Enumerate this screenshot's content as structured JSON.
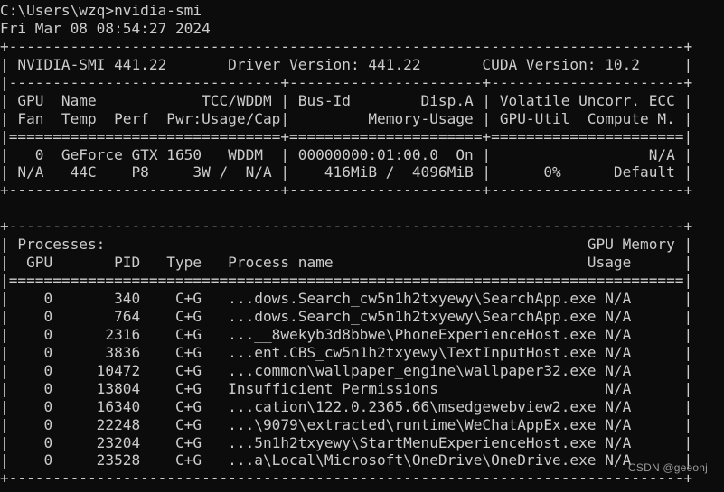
{
  "terminal": {
    "background_color": "#0c0c0c",
    "text_color": "#cccccc",
    "prompt_line": "C:\\Users\\wzq>nvidia-smi",
    "timestamp_line": "Fri Mar 08 08:54:27 2024",
    "blank_line": "",
    "watermark": "CSDN @geeonj"
  },
  "smi_table": {
    "border_top": "+-----------------------------------------------------------------------------+",
    "header_line": "| NVIDIA-SMI 441.22       Driver Version: 441.22       CUDA Version: 10.2     |",
    "divider_dashed": "|-------------------------------+----------------------+----------------------+",
    "col_header_1": "| GPU  Name            TCC/WDDM | Bus-Id        Disp.A | Volatile Uncorr. ECC |",
    "col_header_2": "| Fan  Temp  Perf  Pwr:Usage/Cap|         Memory-Usage | GPU-Util  Compute M. |",
    "divider_equals": "|===============================+======================+======================|",
    "gpu_row_1": "|   0  GeForce GTX 1650   WDDM  | 00000000:01:00.0  On |                  N/A |",
    "gpu_row_2": "| N/A   44C    P8     3W /  N/A |    416MiB /  4096MiB |      0%      Default |",
    "border_bottom": "+-------------------------------+----------------------+----------------------+",
    "fields": {
      "nvidia_smi_version": "441.22",
      "driver_version": "441.22",
      "cuda_version": "10.2",
      "gpu_index": "0",
      "gpu_name": "GeForce GTX 1650",
      "tcc_wddm": "WDDM",
      "bus_id": "00000000:01:00.0",
      "disp_a": "On",
      "ecc": "N/A",
      "fan": "N/A",
      "temp": "44C",
      "perf": "P8",
      "pwr_usage_cap": "3W /  N/A",
      "memory_usage": "416MiB /  4096MiB",
      "gpu_util": "0%",
      "compute_m": "Default"
    }
  },
  "processes_table": {
    "border_top": "+-----------------------------------------------------------------------------+",
    "title_line": "| Processes:                                                       GPU Memory |",
    "header_line": "|  GPU       PID   Type   Process name                             Usage      |",
    "divider_equals": "|=============================================================================|",
    "border_bottom": "+-----------------------------------------------------------------------------+",
    "columns": [
      "GPU",
      "PID",
      "Type",
      "Process name",
      "Usage"
    ],
    "rows": [
      {
        "line": "|    0       340    C+G   ...dows.Search_cw5n1h2txyewy\\SearchApp.exe N/A      |",
        "gpu": "0",
        "pid": "340",
        "type": "C+G",
        "name": "...dows.Search_cw5n1h2txyewy\\SearchApp.exe",
        "usage": "N/A"
      },
      {
        "line": "|    0       764    C+G   ...dows.Search_cw5n1h2txyewy\\SearchApp.exe N/A      |",
        "gpu": "0",
        "pid": "764",
        "type": "C+G",
        "name": "...dows.Search_cw5n1h2txyewy\\SearchApp.exe",
        "usage": "N/A"
      },
      {
        "line": "|    0      2316    C+G   ...__8wekyb3d8bbwe\\PhoneExperienceHost.exe N/A      |",
        "gpu": "0",
        "pid": "2316",
        "type": "C+G",
        "name": "...__8wekyb3d8bbwe\\PhoneExperienceHost.exe",
        "usage": "N/A"
      },
      {
        "line": "|    0      3836    C+G   ...ent.CBS_cw5n1h2txyewy\\TextInputHost.exe N/A      |",
        "gpu": "0",
        "pid": "3836",
        "type": "C+G",
        "name": "...ent.CBS_cw5n1h2txyewy\\TextInputHost.exe",
        "usage": "N/A"
      },
      {
        "line": "|    0     10472    C+G   ...common\\wallpaper_engine\\wallpaper32.exe N/A      |",
        "gpu": "0",
        "pid": "10472",
        "type": "C+G",
        "name": "...common\\wallpaper_engine\\wallpaper32.exe",
        "usage": "N/A"
      },
      {
        "line": "|    0     13804    C+G   Insufficient Permissions                   N/A      |",
        "gpu": "0",
        "pid": "13804",
        "type": "C+G",
        "name": "Insufficient Permissions",
        "usage": "N/A"
      },
      {
        "line": "|    0     16340    C+G   ...cation\\122.0.2365.66\\msedgewebview2.exe N/A      |",
        "gpu": "0",
        "pid": "16340",
        "type": "C+G",
        "name": "...cation\\122.0.2365.66\\msedgewebview2.exe",
        "usage": "N/A"
      },
      {
        "line": "|    0     22248    C+G   ...\\9079\\extracted\\runtime\\WeChatAppEx.exe N/A      |",
        "gpu": "0",
        "pid": "22248",
        "type": "C+G",
        "name": "...\\9079\\extracted\\runtime\\WeChatAppEx.exe",
        "usage": "N/A"
      },
      {
        "line": "|    0     23204    C+G   ...5n1h2txyewy\\StartMenuExperienceHost.exe N/A      |",
        "gpu": "0",
        "pid": "23204",
        "type": "C+G",
        "name": "...5n1h2txyewy\\StartMenuExperienceHost.exe",
        "usage": "N/A"
      },
      {
        "line": "|    0     23528    C+G   ...a\\Local\\Microsoft\\OneDrive\\OneDrive.exe N/A      |",
        "gpu": "0",
        "pid": "23528",
        "type": "C+G",
        "name": "...a\\Local\\Microsoft\\OneDrive\\OneDrive.exe",
        "usage": "N/A"
      }
    ]
  }
}
